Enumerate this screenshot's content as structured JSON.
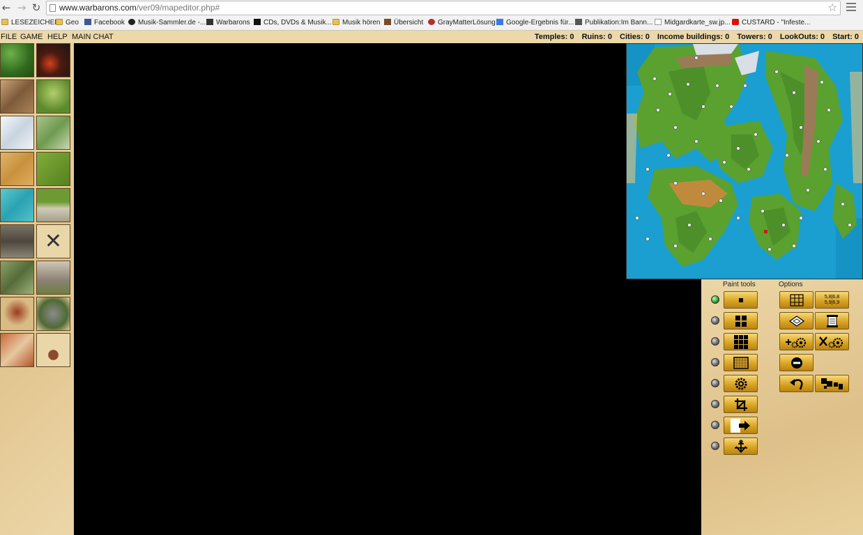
{
  "browser": {
    "url_host": "www.warbarons.com",
    "url_path": "/ver09/mapeditor.php#",
    "bookmarks": [
      {
        "label": "LESEZEICHEN",
        "type": "folder"
      },
      {
        "label": "Geo",
        "type": "folder"
      },
      {
        "label": "Facebook",
        "type": "facebook"
      },
      {
        "label": "Musik-Sammler.de -...",
        "type": "site"
      },
      {
        "label": "Warbarons",
        "type": "site"
      },
      {
        "label": "CDs, DVDs & Musik...",
        "type": "site"
      },
      {
        "label": "Musik hören",
        "type": "folder"
      },
      {
        "label": "Übersicht",
        "type": "site"
      },
      {
        "label": "GrayMatterLösung",
        "type": "site"
      },
      {
        "label": "Google-Ergebnis für...",
        "type": "site"
      },
      {
        "label": "Publikation:Im Bann...",
        "type": "site"
      },
      {
        "label": "Midgardkarte_sw.jp...",
        "type": "page"
      },
      {
        "label": "CUSTARD - \"Infeste...",
        "type": "youtube"
      }
    ]
  },
  "menu": {
    "file": "FILE",
    "game": "GAME",
    "help": "HELP",
    "chat": "MAIN CHAT"
  },
  "stats": {
    "temples": "Temples: 0",
    "ruins": "Ruins: 0",
    "cities": "Cities: 0",
    "income": "Income buildings: 0",
    "towers": "Towers: 0",
    "lookouts": "LookOuts: 0",
    "start": "Start: 0"
  },
  "panel": {
    "paint_tools": "Paint tools",
    "options": "Options",
    "coords_top": "5,8|6,8",
    "coords_bottom": "5,9|6,9"
  },
  "colors": {
    "ocean": "#1a9fd0",
    "grass": "#5aa12f",
    "desert": "#c08a3c",
    "mountain": "#9b7b57",
    "snow": "#d8dfe6",
    "button": "#d9a526"
  }
}
